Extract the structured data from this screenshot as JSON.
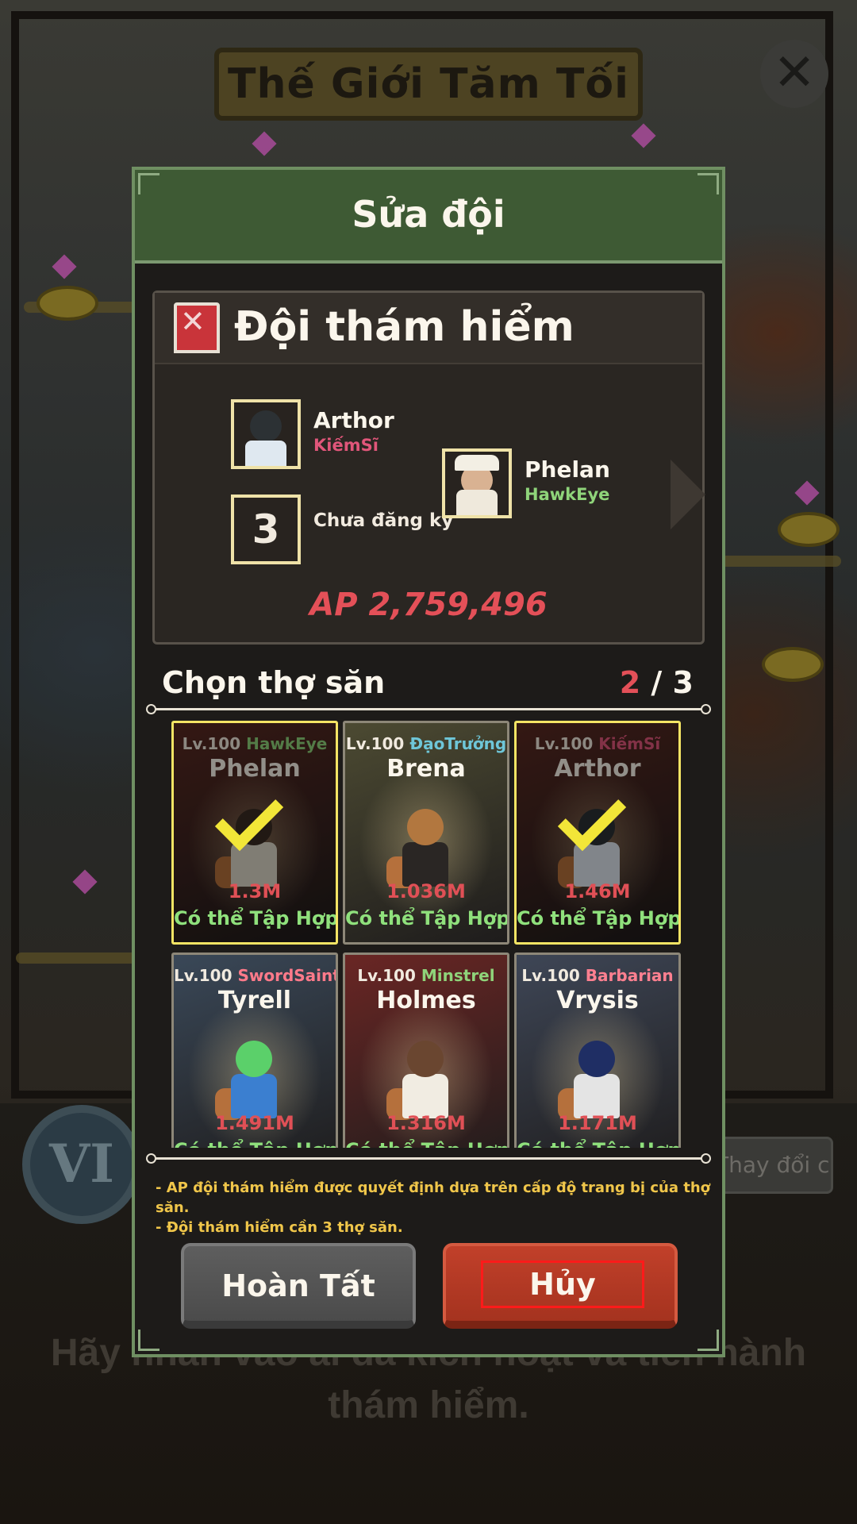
{
  "background": {
    "title": "Thế Giới Tăm Tối",
    "close_glyph": "✕",
    "chapter_numeral": "VI",
    "rank_button_label": "Thay đổi cấp",
    "hint_text": "Hãy nhấn vào ải đã kích hoạt và tiến hành thám hiểm."
  },
  "modal": {
    "title": "Sửa đội",
    "team": {
      "name": "Đội thám hiểm",
      "members": [
        {
          "name": "Arthor",
          "class": "KiếmSĩ",
          "class_color": "#e0567a"
        },
        {
          "name": "Phelan",
          "class": "HawkEye",
          "class_color": "#8fd47a"
        }
      ],
      "empty_slot_number": "3",
      "empty_slot_label": "Chưa đăng ký",
      "ap": "AP 2,759,496"
    },
    "select": {
      "title": "Chọn thợ săn",
      "count_current": "2",
      "count_sep": " / ",
      "count_max": "3"
    },
    "hunters": [
      {
        "level": "Lv.100",
        "class": "HawkEye",
        "class_color": "#8fd47a",
        "name": "Phelan",
        "ap": "1.3M",
        "status": "Có thể Tập Hợp",
        "selected": true,
        "bg": "#5a2a22",
        "body": "#dcd8c8",
        "head": "#3a2c24"
      },
      {
        "level": "Lv.100",
        "class": "ĐạoTrưởng",
        "class_color": "#6ec6d8",
        "name": "Brena",
        "ap": "1.036M",
        "status": "Có thể Tập Hợp",
        "selected": false,
        "bg": "#4c4a32",
        "body": "#2a2624",
        "head": "#b2773f"
      },
      {
        "level": "Lv.100",
        "class": "KiếmSĩ",
        "class_color": "#e0567a",
        "name": "Arthor",
        "ap": "1.46M",
        "status": "Có thể Tập Hợp",
        "selected": true,
        "bg": "#5a2a22",
        "body": "#dfe6ee",
        "head": "#2c3134"
      },
      {
        "level": "Lv.100",
        "class": "SwordSaint",
        "class_color": "#ff7a8a",
        "name": "Tyrell",
        "ap": "1.491M",
        "status": "Có thể Tập Hợp",
        "selected": false,
        "bg": "#3a4858",
        "body": "#3b7fd0",
        "head": "#5bd06a"
      },
      {
        "level": "Lv.100",
        "class": "Minstrel",
        "class_color": "#8fd47a",
        "name": "Holmes",
        "ap": "1.316M",
        "status": "Có thể Tập Hợp",
        "selected": false,
        "bg": "#6a2624",
        "body": "#f1ece2",
        "head": "#6a4630"
      },
      {
        "level": "Lv.100",
        "class": "Barbarian",
        "class_color": "#ff8090",
        "name": "Vrysis",
        "ap": "1.171M",
        "status": "Có thể Tập Hợp",
        "selected": false,
        "bg": "#3e4656",
        "body": "#e4e4e4",
        "head": "#1f2e64"
      }
    ],
    "notes": [
      "- AP đội thám hiểm được quyết định dựa trên cấp độ trang bị của thợ săn.",
      "- Đội thám hiểm cần 3 thợ săn."
    ],
    "buttons": {
      "done": "Hoàn Tất",
      "cancel": "Hủy"
    }
  }
}
